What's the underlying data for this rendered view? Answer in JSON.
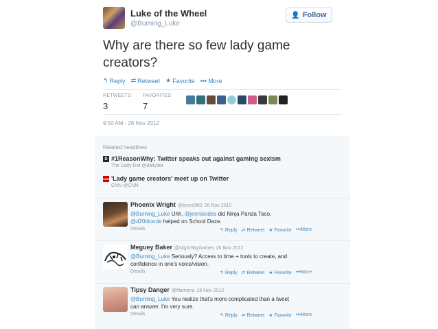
{
  "tweet": {
    "author_name": "Luke of the Wheel",
    "author_handle": "@Burning_Luke",
    "follow_label": "Follow",
    "text_line1": "Why are there so few lady game",
    "text_line2": "creators?",
    "actions": {
      "reply": "Reply",
      "retweet": "Retweet",
      "favorite": "Favorite",
      "more": "More"
    },
    "stats": {
      "retweets_label": "RETWEETS",
      "retweets": "3",
      "favorites_label": "FAVORITES",
      "favorites": "7"
    },
    "timestamp": "9:50 AM - 26 Nov 2012"
  },
  "related": {
    "title": "Related headlines",
    "items": [
      {
        "icon_text": "D",
        "title": "#1ReasonWhy: Twitter speaks out against gaming sexism",
        "source": "The Daily Dot @dailydot"
      },
      {
        "icon_text": "CNN",
        "title": "'Lady game creators' meet up on Twitter",
        "source": "CNN @CNN"
      }
    ]
  },
  "replies": [
    {
      "name": "Phoenix Wright",
      "handle": "@bryce963",
      "date": "26 Nov 2012",
      "mention1": "@Burning_Luke",
      "text1": " Uhh, ",
      "mention2": "@jennisodes",
      "text2": " did Ninja Panda Taco,",
      "mention3": "@d20blonde",
      "text3": " helped on School Daze.",
      "details": "Details"
    },
    {
      "name": "Meguey Baker",
      "handle": "@NightSkyGames",
      "date": "26 Nov 2012",
      "mention1": "@Burning_Luke",
      "text1": " Seriously? Access to time + tools to create, and",
      "text2": "confidence in one's voice/vision.",
      "details": "Details"
    },
    {
      "name": "Tipsy Danger",
      "handle": "@filamena",
      "date": "26 Nov 2012",
      "mention1": "@Burning_Luke",
      "text1": " You realize that's more complicated than a tweet",
      "text2": "can answer. I'm very sure.",
      "details": "Details"
    }
  ],
  "reply_actions": {
    "reply": "Reply",
    "retweet": "Retweet",
    "favorite": "Favorite",
    "more": "More"
  },
  "colors": {
    "link": "#3b88c3",
    "muted": "#8899a6",
    "text": "#292f33",
    "panel": "#f5f8fa"
  }
}
